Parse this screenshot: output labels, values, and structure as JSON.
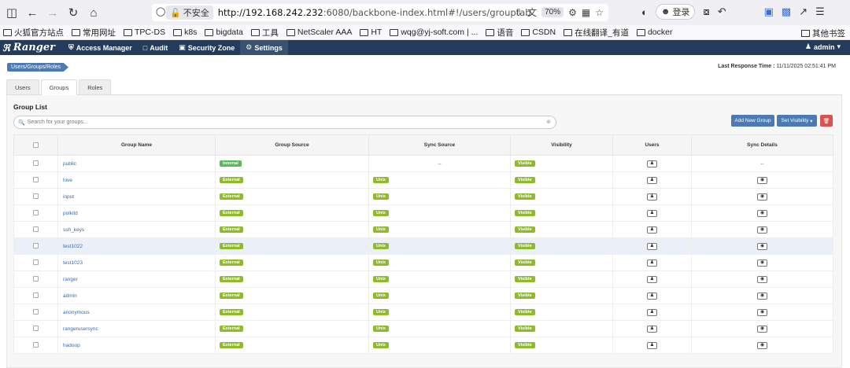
{
  "browser": {
    "url_security": "不安全",
    "url_host": "http://192.168.242.232",
    "url_path": ":6080/backbone-index.html#!/users/grouptab",
    "zoom": "70%",
    "login_label": "登录"
  },
  "bookmarks": {
    "items": [
      "火狐官方站点",
      "常用网址",
      "TPC-DS",
      "k8s",
      "bigdata",
      "工具",
      "NetScaler AAA",
      "HT",
      "wqg@yj-soft.com | ...",
      "语音",
      "CSDN",
      "在线翻译_有道",
      "docker"
    ],
    "other": "其他书签"
  },
  "ranger": {
    "brand": "Ranger",
    "menus": [
      "Access Manager",
      "Audit",
      "Security Zone",
      "Settings"
    ],
    "user": "admin"
  },
  "breadcrumb": "Users/Groups/Roles",
  "last_response": {
    "label": "Last Response Time :",
    "value": "11/11/2025 02:51:41 PM"
  },
  "tabs": [
    "Users",
    "Groups",
    "Roles"
  ],
  "group_list": {
    "title": "Group List",
    "search_placeholder": "Search for your groups...",
    "add_button": "Add New Group",
    "visibility_button": "Set Visibility",
    "columns": [
      "Group Name",
      "Group Source",
      "Sync Source",
      "Visibility",
      "Users",
      "Sync Details"
    ],
    "rows": [
      {
        "name": "public",
        "source": "Internal",
        "sync": "--",
        "visibility": "Visible",
        "details": "--"
      },
      {
        "name": "hive",
        "source": "External",
        "sync": "Unix",
        "visibility": "Visible",
        "details": "eye"
      },
      {
        "name": "input",
        "source": "External",
        "sync": "Unix",
        "visibility": "Visible",
        "details": "eye"
      },
      {
        "name": "polkitd",
        "source": "External",
        "sync": "Unix",
        "visibility": "Visible",
        "details": "eye"
      },
      {
        "name": "ssh_keys",
        "source": "External",
        "sync": "Unix",
        "visibility": "Visible",
        "details": "eye"
      },
      {
        "name": "test1022",
        "source": "External",
        "sync": "Unix",
        "visibility": "Visible",
        "details": "eye"
      },
      {
        "name": "test1023",
        "source": "External",
        "sync": "Unix",
        "visibility": "Visible",
        "details": "eye"
      },
      {
        "name": "ranger",
        "source": "External",
        "sync": "Unix",
        "visibility": "Visible",
        "details": "eye"
      },
      {
        "name": "admin",
        "source": "External",
        "sync": "Unix",
        "visibility": "Visible",
        "details": "eye"
      },
      {
        "name": "anonymous",
        "source": "External",
        "sync": "Unix",
        "visibility": "Visible",
        "details": "eye"
      },
      {
        "name": "rangerusersync",
        "source": "External",
        "sync": "Unix",
        "visibility": "Visible",
        "details": "eye"
      },
      {
        "name": "hadoop",
        "source": "External",
        "sync": "Unix",
        "visibility": "Visible",
        "details": "eye"
      }
    ],
    "highlight_row": 5
  }
}
